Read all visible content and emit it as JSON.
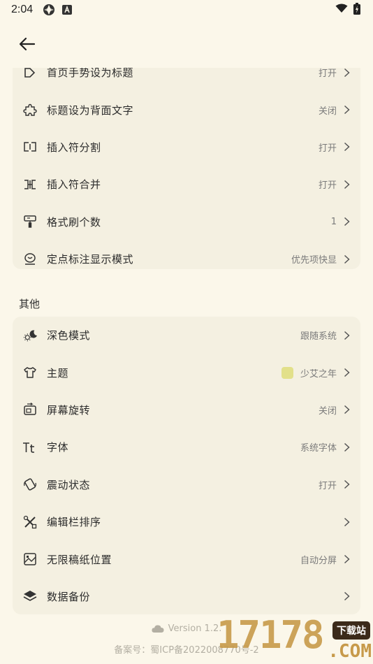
{
  "status_bar": {
    "time": "2:04"
  },
  "card1_rows": [
    {
      "label": "首页手势设为标题",
      "value": "打开",
      "icon": "tag-icon"
    },
    {
      "label": "标题设为背面文字",
      "value": "关闭",
      "icon": "puzzle-icon"
    },
    {
      "label": "插入符分割",
      "value": "打开",
      "icon": "split-icon"
    },
    {
      "label": "插入符合并",
      "value": "打开",
      "icon": "merge-icon"
    },
    {
      "label": "格式刷个数",
      "value": "1",
      "icon": "format-brush-icon"
    },
    {
      "label": "定点标注显示模式",
      "value": "优先项快显",
      "icon": "pin-icon"
    }
  ],
  "section_other": {
    "title": "其他"
  },
  "card2_rows": [
    {
      "label": "深色模式",
      "value": "跟随系统",
      "icon": "sun-moon-icon"
    },
    {
      "label": "主题",
      "value": "少艾之年",
      "icon": "shirt-icon",
      "swatch_color": "#e2e08a"
    },
    {
      "label": "屏幕旋转",
      "value": "关闭",
      "icon": "screen-rotate-icon"
    },
    {
      "label": "字体",
      "value": "系统字体",
      "icon": "font-icon"
    },
    {
      "label": "震动状态",
      "value": "打开",
      "icon": "vibrate-icon"
    },
    {
      "label": "编辑栏排序",
      "value": "",
      "icon": "tools-icon"
    },
    {
      "label": "无限稿纸位置",
      "value": "自动分屏",
      "icon": "canvas-icon"
    },
    {
      "label": "数据备份",
      "value": "",
      "icon": "layers-icon"
    }
  ],
  "footer": {
    "version": "Version 1.2.",
    "icp": "备案号：蜀ICP备2022008770号-2"
  },
  "watermark": {
    "digits": "17178",
    "badge": "下载站",
    "domain": ".COM"
  },
  "colors": {
    "background": "#fbf7ea",
    "card": "#f4f0e1",
    "swatch": "#e2e08a",
    "watermark": "#c79a4a"
  }
}
